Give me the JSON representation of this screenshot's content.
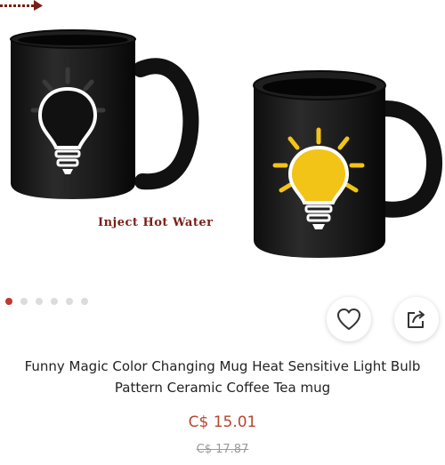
{
  "gallery": {
    "caption": "Inject  Hot Water",
    "slide_count": 6,
    "active_index": 0
  },
  "actions": {
    "favorite_icon": "heart-outline-icon",
    "share_icon": "share-arrow-icon"
  },
  "product": {
    "title": "Funny Magic Color Changing Mug Heat Sensitive Light Bulb Pattern Ceramic Coffee Tea mug",
    "price": "C$ 15.01",
    "original_price": "C$ 17.87"
  },
  "colors": {
    "price": "#b7472f",
    "active_dot": "#c0392b",
    "caption": "#7a1f17",
    "bulb_lit": "#f2c417"
  }
}
